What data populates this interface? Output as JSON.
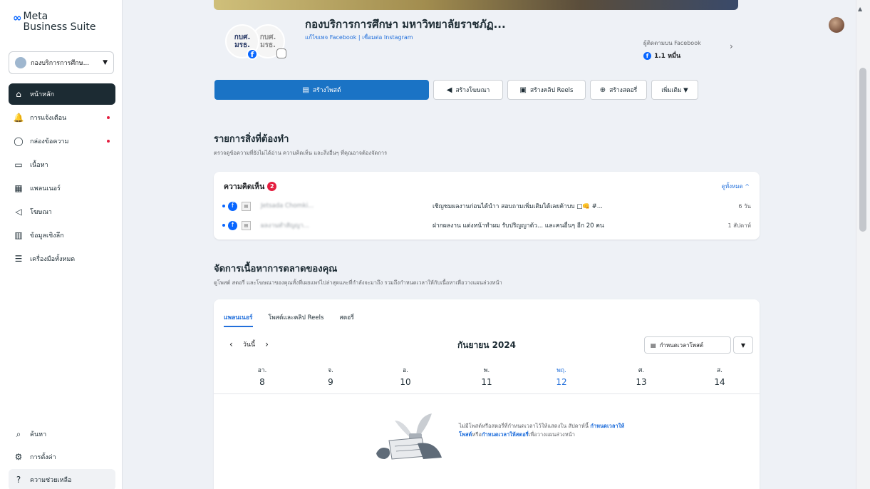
{
  "app": {
    "logo_mark": "∞",
    "logo_line1": "Meta",
    "logo_line2": "Business Suite"
  },
  "account": {
    "label": "กองบริการการศึกษ...",
    "caret": "▼"
  },
  "nav": [
    {
      "label": "หน้าหลัก",
      "icon": "⌂",
      "active": true
    },
    {
      "label": "การแจ้งเตือน",
      "icon": "🔔",
      "dot": true
    },
    {
      "label": "กล่องข้อความ",
      "icon": "◯",
      "dot": true
    },
    {
      "label": "เนื้อหา",
      "icon": "▭"
    },
    {
      "label": "แพลนเนอร์",
      "icon": "▦"
    },
    {
      "label": "โฆษณา",
      "icon": "◁"
    },
    {
      "label": "ข้อมูลเชิงลึก",
      "icon": "▥"
    },
    {
      "label": "เครื่องมือทั้งหมด",
      "icon": "☰"
    }
  ],
  "bottom_nav": [
    {
      "label": "ค้นหา",
      "icon": "⌕"
    },
    {
      "label": "การตั้งค่า",
      "icon": "⚙"
    },
    {
      "label": "ความช่วยเหลือ",
      "icon": "?"
    }
  ],
  "profile": {
    "pic1_text": "กบศ. มรธ.",
    "pic2_text": "กบศ. มรธ.",
    "title": "กองบริการการศึกษา มหาวิทยาลัยราชภัฏ...",
    "links": "แก้ไขเพจ Facebook | เชื่อมต่อ Instagram",
    "followers_label": "ผู้ติดตามบน Facebook",
    "followers_value": "1.1 หมื่น",
    "chevron": "›"
  },
  "actions": {
    "create_post": "สร้างโพสต์",
    "create_ad": "สร้างโฆษณา",
    "create_reel": "สร้างคลิป Reels",
    "create_story": "สร้างสตอรี่",
    "more": "เพิ่มเติม ▼"
  },
  "todo": {
    "title": "รายการสิ่งที่ต้องทำ",
    "subtitle": "ตรวจดูข้อความที่ยังไม่ได้อ่าน ความคิดเห็น และสิ่งอื่นๆ ที่คุณอาจต้องจัดการ"
  },
  "comments": {
    "title": "ความคิดเห็น",
    "count": "2",
    "see_all": "ดูทั้งหมด ^",
    "rows": [
      {
        "name": "Jetsada Chomki...",
        "text": "เชิญชมผลงานก่อนได้นำา สอบถามเพิ่มเติมได้เลยค้าบบ □👊 #...",
        "time": "6 วัน"
      },
      {
        "name": "ผลงานทำสัญญา...",
        "text": "ฝากผลงาน แต่งหน้าทำผม รับปริญญาด้ว... และคนอื่นๆ อีก 20 คน",
        "time": "1 สัปดาห์"
      }
    ]
  },
  "manage": {
    "title": "จัดการเนื้อหาการตลาดของคุณ",
    "subtitle": "ดูโพสต์ สตอรี่ และโฆษณาของคุณทั้งที่เผยแพร่ไปล่าสุดและที่กำลังจะมาถึง รวมถึงกำหนดเวลาให้กับเนื้อหาเพื่อวางแผนล่วงหน้า"
  },
  "planner": {
    "tabs": [
      "แพลนเนอร์",
      "โพสต์และคลิป Reels",
      "สตอรี่"
    ],
    "today_label": "วันนี้",
    "prev": "‹",
    "next": "›",
    "month": "กันยายน 2024",
    "schedule_label": "กำหนดเวลาโพสต์",
    "caret": "▼",
    "days": [
      {
        "name": "อา.",
        "num": "8"
      },
      {
        "name": "จ.",
        "num": "9"
      },
      {
        "name": "อ.",
        "num": "10"
      },
      {
        "name": "พ.",
        "num": "11"
      },
      {
        "name": "พฤ.",
        "num": "12",
        "today": true
      },
      {
        "name": "ศ.",
        "num": "13"
      },
      {
        "name": "ส.",
        "num": "14"
      }
    ],
    "empty_text1": "ไม่มีโพสต์หรือสตอรี่ที่กำหนดเวลาไว้ให้แสดงใน สัปดาห์นี้ ",
    "empty_link1": "กำหนดเวลาให้โพสต์",
    "empty_text2": "หรือ",
    "empty_link2": "กำหนดเวลาให้สตอรี่",
    "empty_text3": "เพื่อวางแผนล่วงหน้า"
  },
  "colors": {
    "accent": "#1a73c5",
    "link": "#216fdb",
    "alert": "#e41e3f",
    "nav_active": "#1c2b33"
  }
}
